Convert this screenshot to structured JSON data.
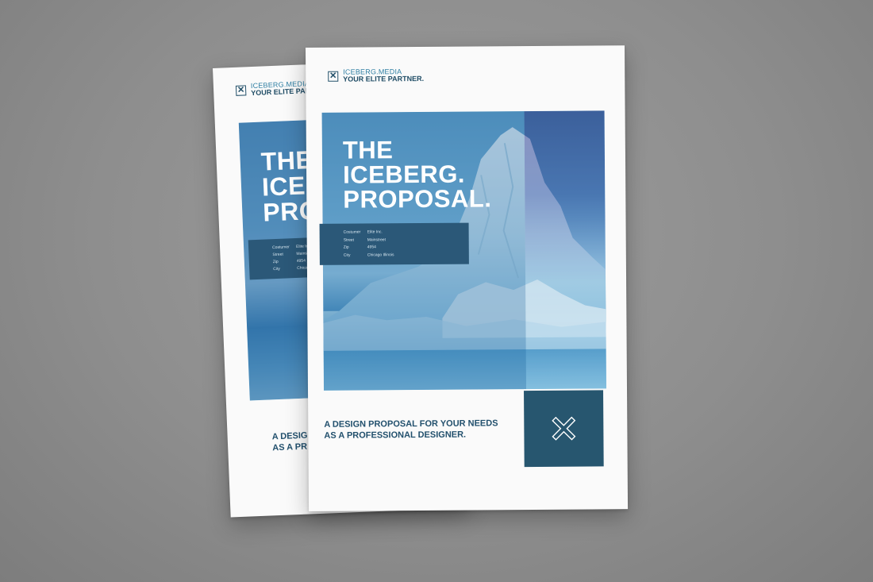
{
  "brand": {
    "name": "ICEBERG.MEDIA",
    "slogan": "YOUR ELITE PARTNER.",
    "logo_icon": "cross-icon"
  },
  "cover": {
    "title_lines": [
      "THE",
      "ICEBERG.",
      "PROPOSAL."
    ],
    "tagline_lines": [
      "A DESIGN PROPOSAL FOR YOUR NEEDS",
      "AS A PROFESSIONAL DESIGNER."
    ],
    "corner_icon": "cross-icon"
  },
  "back_page": {
    "title_lines": [
      "THE",
      "ICE",
      "PROP"
    ],
    "tagline_lines": [
      "A DESIG",
      "AS A PR"
    ],
    "info_labels": [
      "Costumer",
      "Street",
      "Zip",
      "City"
    ],
    "info_values": [
      "Elite Inc.",
      "Mainstreet",
      "4954",
      "Chicago"
    ]
  },
  "info": {
    "labels": [
      "Costumer",
      "Street",
      "Zip",
      "City"
    ],
    "values": [
      "Elite Inc.",
      "Mainstreet",
      "4954",
      "Chicago Illinois"
    ]
  },
  "colors": {
    "background": "#909090",
    "paper": "#fafafa",
    "brand_dark": "#27566f",
    "brand_light": "#2f7fa3"
  }
}
